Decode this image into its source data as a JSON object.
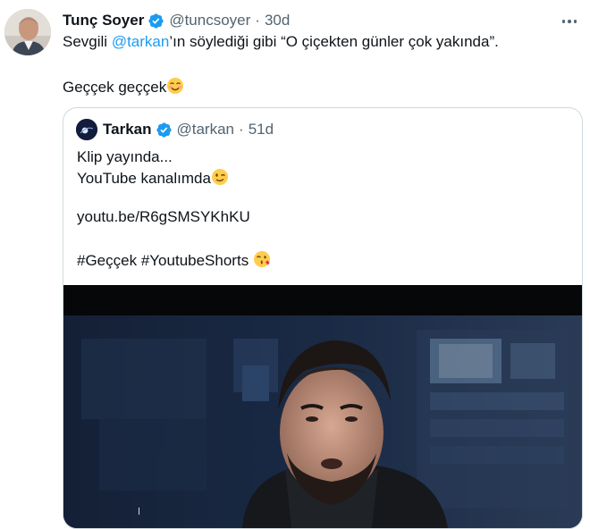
{
  "tweet": {
    "author_name": "Tunç Soyer",
    "author_handle": "@tuncsoyer",
    "separator": "·",
    "time": "30d",
    "text_prefix": "Sevgili ",
    "mention": "@tarkan",
    "text_suffix": "’ın söylediği gibi “O çiçekten günler çok yakında”.",
    "line2": "Geççek geççek",
    "line2_emoji": "smiling-face-icon"
  },
  "quote": {
    "author_name": "Tarkan",
    "author_handle": "@tarkan",
    "separator": "·",
    "time": "51d",
    "line1": "Klip yayında...",
    "line2": "YouTube kanalımda",
    "line2_emoji": "winking-face-icon",
    "link": "youtu.be/R6gSMSYKhKU",
    "hashtag1": "#Geççek",
    "hashtag2": "#YoutubeShorts",
    "hashtag_emoji": "kissing-face-icon"
  },
  "colors": {
    "accent": "#1d9bf0",
    "text": "#0f1419",
    "secondary": "#536471",
    "border": "#cfd9de"
  }
}
